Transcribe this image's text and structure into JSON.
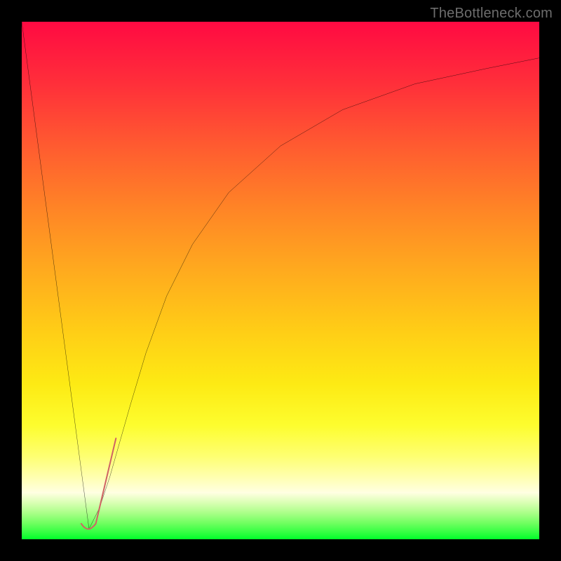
{
  "watermark_text": "TheBottleneck.com",
  "colors": {
    "curve_black": "#000000",
    "accent_stroke": "#cf6363"
  },
  "chart_data": {
    "type": "line",
    "title": "",
    "xlabel": "",
    "ylabel": "",
    "xlim": [
      0,
      100
    ],
    "ylim": [
      0,
      100
    ],
    "series": [
      {
        "name": "left-line",
        "x": [
          0,
          13
        ],
        "y": [
          100,
          2
        ]
      },
      {
        "name": "right-curve",
        "x": [
          13,
          15,
          17,
          19,
          21,
          24,
          28,
          33,
          40,
          50,
          62,
          76,
          90,
          100
        ],
        "y": [
          2,
          6,
          12,
          19,
          26,
          36,
          47,
          57,
          67,
          76,
          83,
          88,
          91,
          93
        ]
      },
      {
        "name": "accent-j-mark",
        "x": [
          11.5,
          13.5,
          14.3,
          18.2
        ],
        "y": [
          3.0,
          2.2,
          3.0,
          19.5
        ]
      }
    ]
  }
}
